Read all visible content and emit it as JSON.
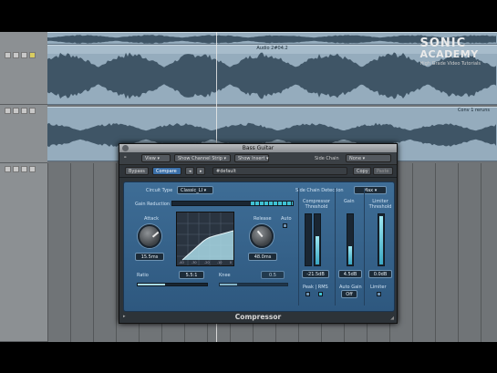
{
  "watermark": {
    "line1": "SONIC",
    "line2": "ACADEMY",
    "line3": "High Grade Video Tutorials"
  },
  "tracks": [
    {
      "region_label": "Audio 2#04.2"
    },
    {
      "region_label": "Guitar"
    },
    {
      "region_label": "Conv 1 reruns"
    }
  ],
  "plugin": {
    "title": "Bass Guitar",
    "view_label": "View",
    "show_channel_strip_label": "Show Channel Strip",
    "show_insert_label": "Show Insert",
    "side_chain_label": "Side Chain",
    "side_chain_value": "None",
    "bypass_label": "Bypass",
    "compare_label": "Compare",
    "prev_label": "◂",
    "next_label": "▸",
    "preset_name": "#default",
    "copy_label": "Copy",
    "paste_label": "Paste",
    "circuit_type_label": "Circuit Type",
    "circuit_type_value": "Classic_LI",
    "side_chain_detection_label": "Side Chain Detection",
    "side_chain_detection_value": "Max",
    "gain_reduction_label": "Gain Reduction",
    "gain_reduction_level": 0.35,
    "attack_label": "Attack",
    "attack_value": "15.5ms",
    "release_label": "Release",
    "release_value": "48.0ms",
    "auto_label": "Auto",
    "graph_ticks": [
      "-40",
      "-30",
      "-20",
      "-10",
      "0"
    ],
    "ratio_label": "Ratio",
    "ratio_value": "5.5:1",
    "ratio_level": 0.4,
    "knee_label": "Knee",
    "knee_value": "0.5",
    "knee_level": 0.25,
    "compressor_threshold_label": "Compressor Threshold",
    "compressor_threshold_value": "-21.5dB",
    "compressor_threshold_level": 0.55,
    "gain_label": "Gain",
    "gain_value": "4.5dB",
    "gain_level": 0.35,
    "limiter_threshold_label": "Limiter Threshold",
    "limiter_threshold_value": "0.0dB",
    "limiter_threshold_level": 0.95,
    "peak_rms_label": "Peak | RMS",
    "auto_gain_label": "Auto Gain",
    "auto_gain_value": "Off",
    "limiter_label": "Limiter",
    "footer_title": "Compressor"
  },
  "colors": {
    "panel": "#3a6890",
    "meter_cyan": "#3fc2d4",
    "region": "#95acbd"
  }
}
